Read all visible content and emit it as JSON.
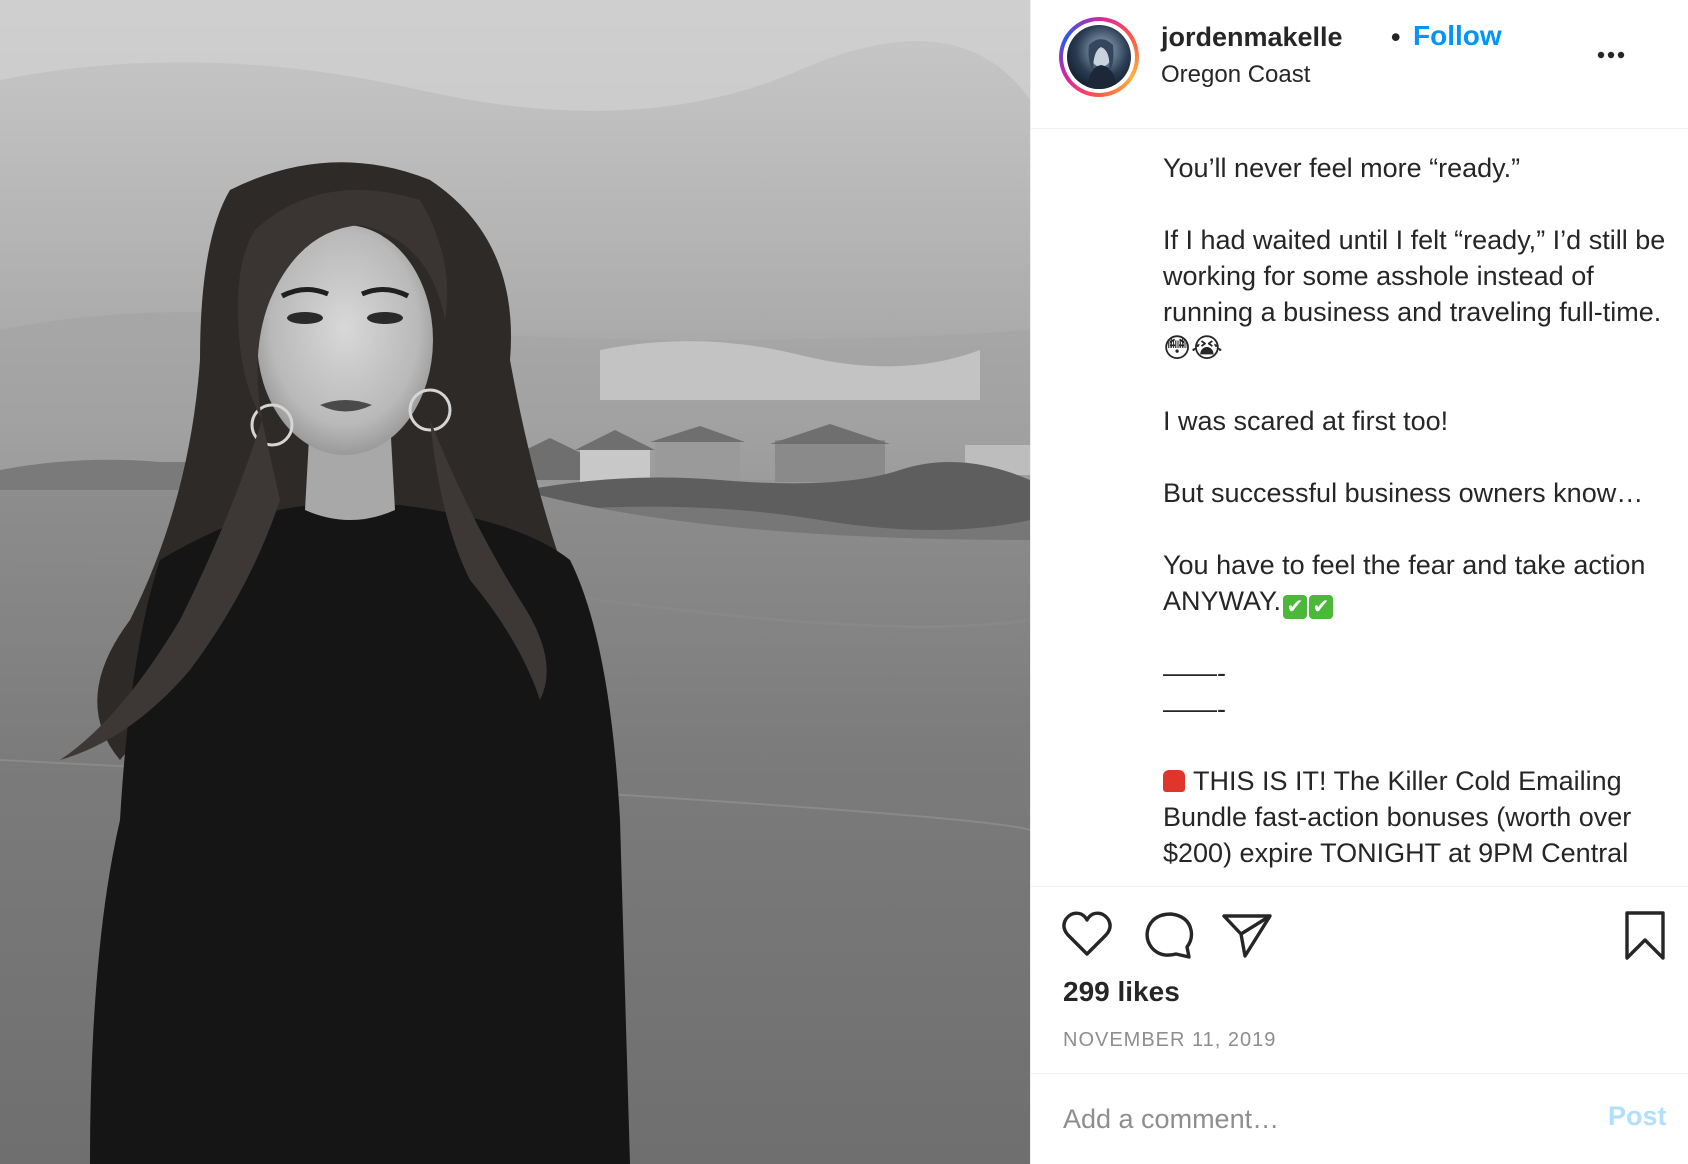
{
  "post": {
    "username": "jordenmakelle",
    "separator": "•",
    "follow_label": "Follow",
    "location": "Oregon Coast",
    "caption": {
      "line1": "You’ll never feel more “ready.”",
      "para2": "If I had waited until I felt “ready,” I’d still be working for some asshole instead of running a business and traveling full-time.",
      "para2_emoji": "😳😭",
      "para3": "I was scared at first too!",
      "para4": "But successful business owners know…",
      "para5": "You have to feel the fear and take action ANYWAY.",
      "para5_emoji": "✔",
      "divider1": "——-",
      "divider2": "——-",
      "para6": "THIS IS IT! The Killer Cold Emailing Bundle fast-action bonuses (worth over $200) expire TONIGHT at 9PM Central"
    },
    "likes": "299 likes",
    "date": "NOVEMBER 11, 2019"
  },
  "comment": {
    "placeholder": "Add a comment…",
    "post_label": "Post"
  },
  "icons": {
    "more": "more-options-icon",
    "like": "heart-icon",
    "comment": "comment-bubble-icon",
    "share": "paper-plane-icon",
    "save": "bookmark-icon"
  },
  "colors": {
    "follow": "#0095f6",
    "post_disabled": "#b2dffc",
    "text": "#262626",
    "muted": "#8e8e8e"
  }
}
